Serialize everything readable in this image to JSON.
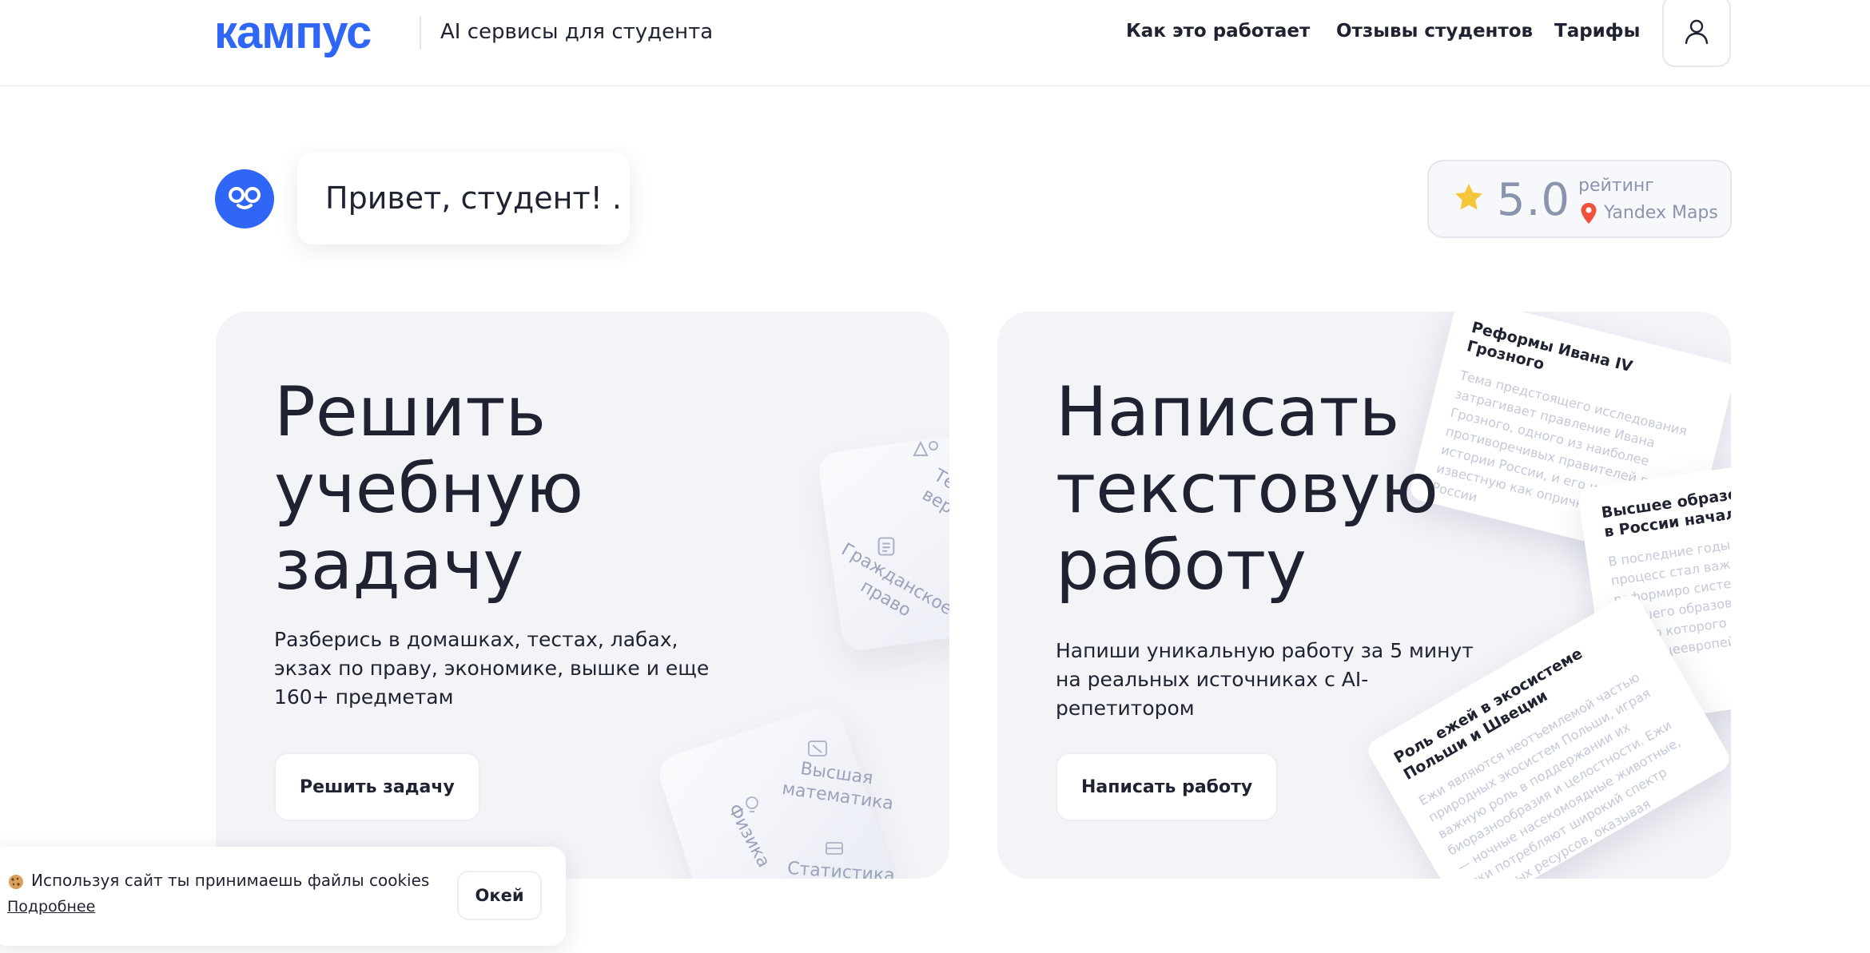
{
  "header": {
    "logo_text": "кампус",
    "tagline": "AI сервисы для студента",
    "nav": [
      {
        "label": "Как это работает"
      },
      {
        "label": "Отзывы студентов"
      },
      {
        "label": "Тарифы"
      }
    ],
    "user_icon": "user-icon"
  },
  "greeting": {
    "text": "Привет, студент! ."
  },
  "rating": {
    "value": "5.0",
    "label": "рейтинг",
    "source": "Yandex Maps"
  },
  "cards": [
    {
      "title_lines": [
        "Решить",
        "учебную",
        "задачу"
      ],
      "description": "Разберись в домашках, тестах, лабах, экзах по праву, экономике, вышке и еще 160+ предметам",
      "button": "Решить задачу",
      "cubes": [
        "Гражданское право",
        "Тес вер",
        "Высшая математика",
        "Физика",
        "Статистика"
      ]
    },
    {
      "title_lines": [
        "Написать",
        "текстовую",
        "работу"
      ],
      "description": "Напиши уникальную работу за 5 минут на реальных источниках с AI-репетитором",
      "button": "Написать работу",
      "sheets": [
        {
          "title": "Реформы Ивана IV Грозного",
          "body": "Тема предстоящего исследования затрагивает правление Ивана Грозного, одного из наиболее противоречивых правителей в истории России, и его инициативу, известную как опричнина. XVI век в России"
        },
        {
          "title": "Высшее образование в России начала XX",
          "body": "В последние годы Бол процесс стал важной частью реформиро системы высшего образования в Р целью которого интеграция в е общеевропейс"
        },
        {
          "title": "Роль ежей в экосистеме Польши и Швеции",
          "body": "Ежи являются неотъемлемой частью природных экосистем Польши, играя важную роль в поддержании их биоразнообразия и целостности. Ежи — ночные насекомоядные животные, ежи потребляют широкий спектр пищевых ресурсов, оказывая"
        }
      ]
    }
  ],
  "cookie": {
    "text": "Используя сайт ты принимаешь файлы cookies",
    "more": "Подробнее",
    "ok": "Окей"
  }
}
